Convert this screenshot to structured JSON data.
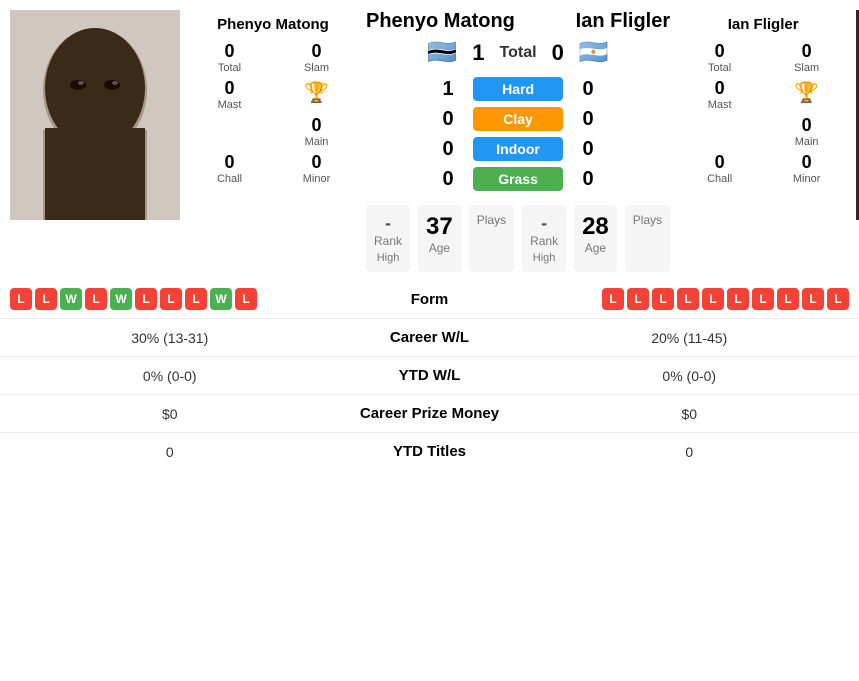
{
  "players": {
    "left": {
      "name": "Phenyo Matong",
      "flag_emoji": "🇧🇼",
      "flag_name": "Botswana flag",
      "photo_exists": true,
      "stats": {
        "total": "0",
        "slam": "0",
        "mast": "0",
        "main": "0",
        "chall": "0",
        "minor": "0"
      },
      "rank_card": {
        "rank_value": "-",
        "rank_label": "Rank",
        "high_label": "High"
      },
      "age": "37",
      "age_label": "Age",
      "plays_label": "Plays",
      "form": [
        "L",
        "L",
        "W",
        "L",
        "W",
        "L",
        "L",
        "L",
        "W",
        "L"
      ],
      "career_wl": "30% (13-31)",
      "ytd_wl": "0% (0-0)",
      "career_prize": "$0",
      "ytd_titles": "0"
    },
    "right": {
      "name": "Ian Fligler",
      "flag_emoji": "🇦🇷",
      "flag_name": "Argentina flag",
      "photo_exists": false,
      "stats": {
        "total": "0",
        "slam": "0",
        "mast": "0",
        "main": "0",
        "chall": "0",
        "minor": "0"
      },
      "rank_card": {
        "rank_value": "-",
        "rank_label": "Rank",
        "high_label": "High"
      },
      "age": "28",
      "age_label": "Age",
      "plays_label": "Plays",
      "form": [
        "L",
        "L",
        "L",
        "L",
        "L",
        "L",
        "L",
        "L",
        "L",
        "L"
      ],
      "career_wl": "20% (11-45)",
      "ytd_wl": "0% (0-0)",
      "career_prize": "$0",
      "ytd_titles": "0"
    }
  },
  "match": {
    "total_left": "1",
    "total_right": "0",
    "total_label": "Total",
    "hard_left": "1",
    "hard_right": "0",
    "clay_left": "0",
    "clay_right": "0",
    "indoor_left": "0",
    "indoor_right": "0",
    "grass_left": "0",
    "grass_right": "0",
    "surfaces": {
      "hard": "Hard",
      "clay": "Clay",
      "indoor": "Indoor",
      "grass": "Grass"
    }
  },
  "labels": {
    "form": "Form",
    "career_wl": "Career W/L",
    "ytd_wl": "YTD W/L",
    "career_prize": "Career Prize Money",
    "ytd_titles": "YTD Titles",
    "total_label": "Total",
    "slam_label": "Slam",
    "mast_label": "Mast",
    "main_label": "Main",
    "chall_label": "Chall",
    "minor_label": "Minor"
  }
}
